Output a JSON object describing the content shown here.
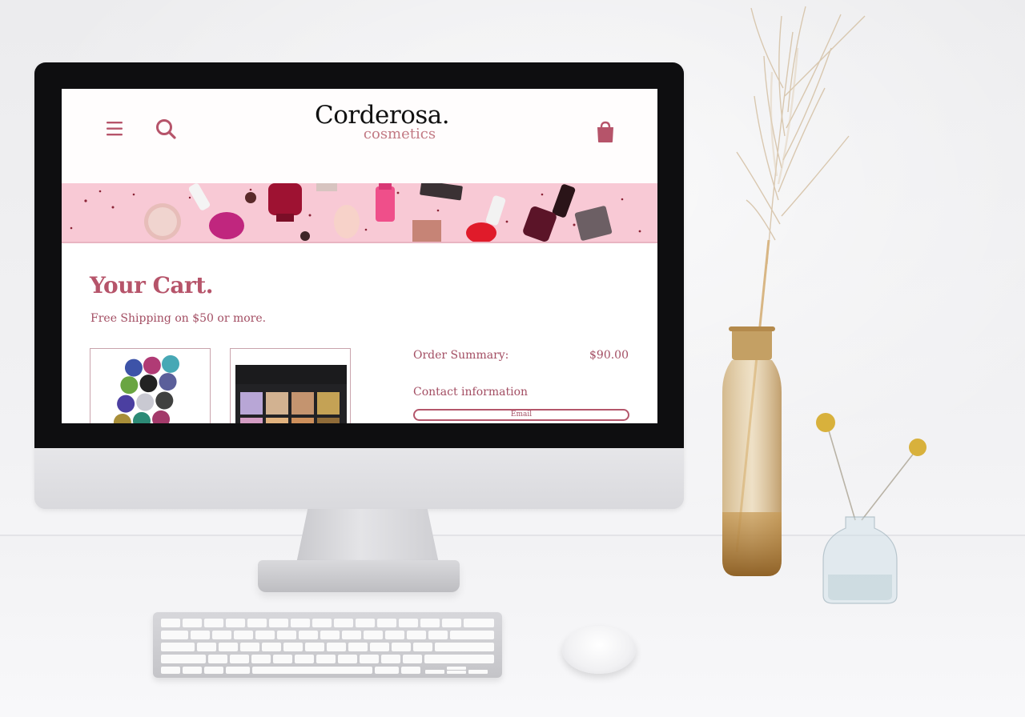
{
  "site": {
    "brand": "Corderosa.",
    "brand_sub": "cosmetics"
  },
  "header": {
    "icons": [
      "menu-icon",
      "search-icon",
      "shopping-bag-icon"
    ]
  },
  "cart": {
    "title": "Your Cart.",
    "shipping_note": "Free Shipping on $50 or more.",
    "items": [
      {
        "image": "glitter-pots-photo"
      },
      {
        "image": "eyeshadow-palette-photo"
      }
    ]
  },
  "summary": {
    "label": "Order Summary:",
    "total": "$90.00",
    "contact_label": "Contact information",
    "email_placeholder": "Email"
  },
  "colors": {
    "accent": "#b6546a",
    "banner": "#f7c7d3",
    "logo_sub": "#c27a84"
  }
}
